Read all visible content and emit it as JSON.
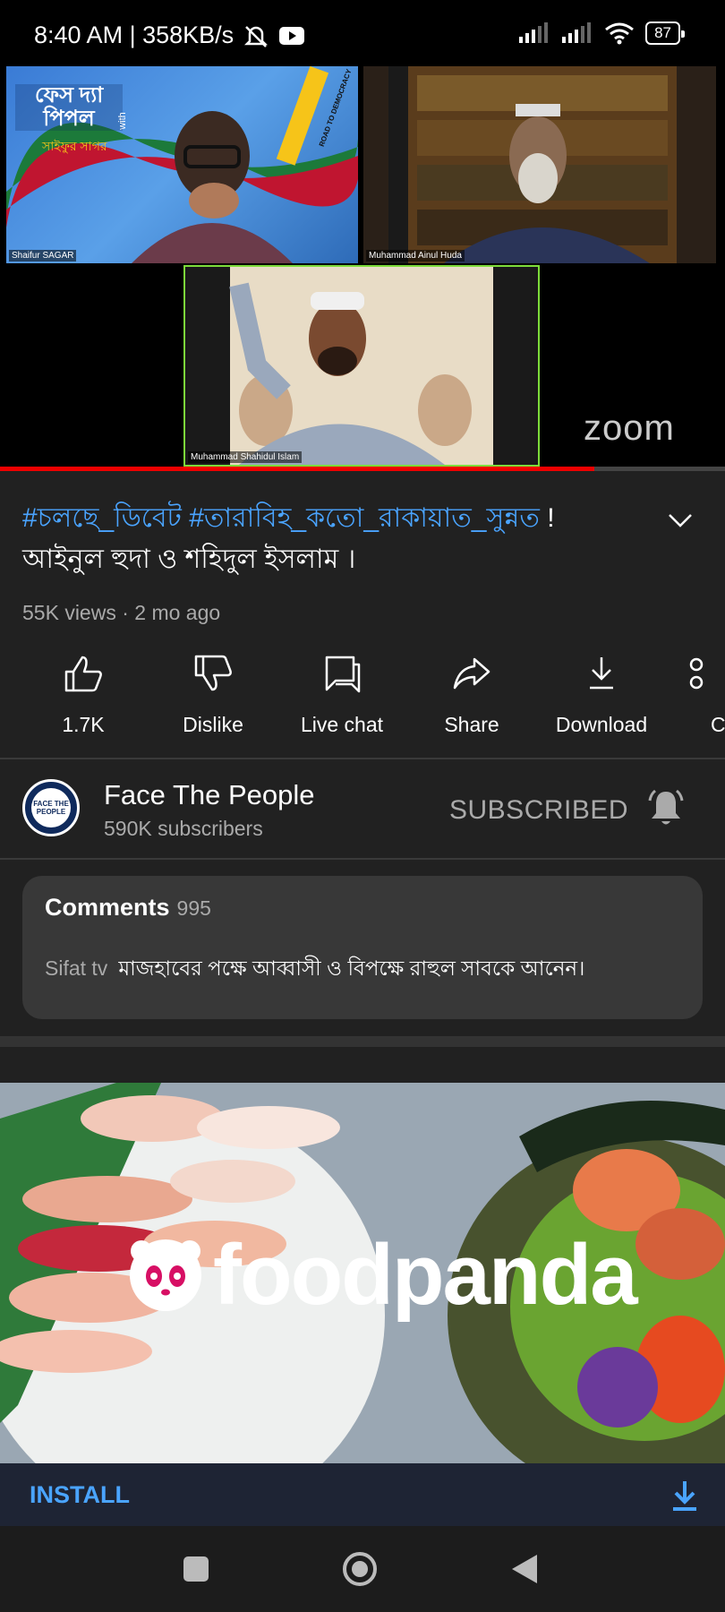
{
  "status_bar": {
    "time_speed": "8:40 AM | 358KB/s",
    "battery": "87",
    "icons": [
      "mute-bell-icon",
      "youtube-icon",
      "signal-icon",
      "signal-icon",
      "wifi-icon",
      "battery-icon"
    ]
  },
  "video": {
    "participants": [
      "Shaifur SAGAR",
      "Muhammad Ainul Huda",
      "Muhammad Shahidul Islam"
    ],
    "watermark": "zoom",
    "progress": 0.82,
    "banner_text": "ফেস দ্যা পিপল",
    "banner_sub": "সাইফুর সাগর",
    "banner_with": "with",
    "road_text": "ROAD TO DEMOCRACY"
  },
  "title": {
    "hashtags": "#চলছে_ডিবেট #তারাবিহ_কতো_রাকায়াত_সুন্নত",
    "bang": " !",
    "line2": "আইনুল হুদা ও শহিদুল ইসলাম ।"
  },
  "meta": "55K views · 2 mo ago",
  "actions": [
    {
      "label": "1.7K",
      "icon": "thumbs-up-icon"
    },
    {
      "label": "Dislike",
      "icon": "thumbs-down-icon"
    },
    {
      "label": "Live chat",
      "icon": "chat-icon"
    },
    {
      "label": "Share",
      "icon": "share-icon"
    },
    {
      "label": "Download",
      "icon": "download-icon"
    },
    {
      "label": "C",
      "icon": "clip-icon"
    }
  ],
  "channel": {
    "name": "Face The People",
    "subscribers": "590K subscribers",
    "subscribed_label": "SUBSCRIBED",
    "avatar_text": "FACE THE PEOPLE"
  },
  "comments": {
    "title": "Comments",
    "count": "995",
    "author": "Sifat tv",
    "text": "মাজহাবের পক্ষে আব্বাসী ও বিপক্ষে রাহুল সাবকে আনেন।"
  },
  "ad": {
    "brand": "foodpanda",
    "install_label": "INSTALL"
  },
  "colors": {
    "accent_blue": "#4aa4ff",
    "progress_red": "#ee0000",
    "zoom_border": "#7ddc3a"
  }
}
